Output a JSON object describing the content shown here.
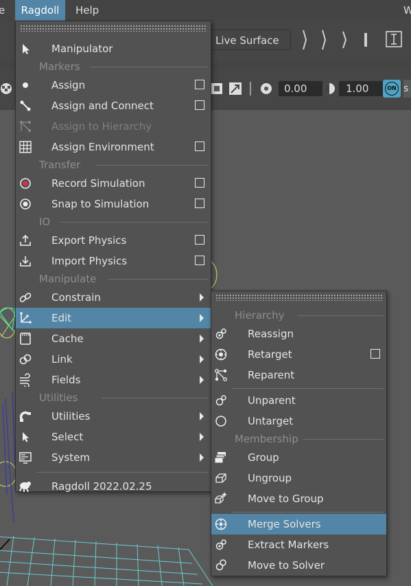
{
  "menubar": {
    "items": [
      {
        "label": "e",
        "active": false
      },
      {
        "label": "Ragdoll",
        "active": true
      },
      {
        "label": "Help",
        "active": false
      }
    ],
    "right_fragment": "W"
  },
  "toolbar": {
    "live_surface": "Live Surface",
    "field1": "0.00",
    "field2": "1.00",
    "on_badge": "ON",
    "partial": "s"
  },
  "main_menu": {
    "items": [
      {
        "type": "item",
        "label": "Manipulator",
        "icon": "pointer-icon"
      },
      {
        "type": "section",
        "label": "Markers"
      },
      {
        "type": "item",
        "label": "Assign",
        "icon": "dot-icon",
        "option": true
      },
      {
        "type": "item",
        "label": "Assign and Connect",
        "icon": "connect-icon",
        "option": true
      },
      {
        "type": "item",
        "label": "Assign to Hierarchy",
        "icon": "hierarchy-icon",
        "disabled": true
      },
      {
        "type": "item",
        "label": "Assign Environment",
        "icon": "grid-icon",
        "option": true
      },
      {
        "type": "section",
        "label": "Transfer"
      },
      {
        "type": "item",
        "label": "Record Simulation",
        "icon": "record-icon",
        "option": true
      },
      {
        "type": "item",
        "label": "Snap to Simulation",
        "icon": "snap-icon",
        "option": true
      },
      {
        "type": "section",
        "label": "IO"
      },
      {
        "type": "item",
        "label": "Export Physics",
        "icon": "export-icon",
        "option": true
      },
      {
        "type": "item",
        "label": "Import Physics",
        "icon": "import-icon",
        "option": true
      },
      {
        "type": "section",
        "label": "Manipulate"
      },
      {
        "type": "item",
        "label": "Constrain",
        "icon": "chain-icon",
        "submenu": true
      },
      {
        "type": "item",
        "label": "Edit",
        "icon": "edit-axes-icon",
        "submenu": true,
        "active": true
      },
      {
        "type": "item",
        "label": "Cache",
        "icon": "film-icon",
        "submenu": true
      },
      {
        "type": "item",
        "label": "Link",
        "icon": "link-icon",
        "submenu": true
      },
      {
        "type": "item",
        "label": "Fields",
        "icon": "wind-icon",
        "submenu": true
      },
      {
        "type": "section",
        "label": "Utilities"
      },
      {
        "type": "item",
        "label": "Utilities",
        "icon": "magnet-icon",
        "submenu": true
      },
      {
        "type": "item",
        "label": "Select",
        "icon": "select-arrow-icon",
        "submenu": true
      },
      {
        "type": "item",
        "label": "System",
        "icon": "monitor-icon",
        "submenu": true
      },
      {
        "type": "divider"
      },
      {
        "type": "item",
        "label": "Ragdoll 2022.02.25",
        "icon": "ragdoll-logo-icon"
      }
    ]
  },
  "sub_menu": {
    "items": [
      {
        "type": "section",
        "label": "Hierarchy"
      },
      {
        "type": "item",
        "label": "Reassign",
        "icon": "reassign-icon"
      },
      {
        "type": "item",
        "label": "Retarget",
        "icon": "target-icon",
        "option": true
      },
      {
        "type": "item",
        "label": "Reparent",
        "icon": "reparent-icon"
      },
      {
        "type": "divider"
      },
      {
        "type": "item",
        "label": "Unparent",
        "icon": "unparent-icon"
      },
      {
        "type": "item",
        "label": "Untarget",
        "icon": "circle-icon"
      },
      {
        "type": "section",
        "label": "Membership"
      },
      {
        "type": "item",
        "label": "Group",
        "icon": "group-icon"
      },
      {
        "type": "item",
        "label": "Ungroup",
        "icon": "ungroup-icon"
      },
      {
        "type": "item",
        "label": "Move to Group",
        "icon": "move-group-icon"
      },
      {
        "type": "divider"
      },
      {
        "type": "item",
        "label": "Merge Solvers",
        "icon": "merge-icon",
        "active": true
      },
      {
        "type": "item",
        "label": "Extract Markers",
        "icon": "extract-icon"
      },
      {
        "type": "item",
        "label": "Move to Solver",
        "icon": "move-solver-icon"
      }
    ]
  },
  "colors": {
    "highlight": "#5285a6",
    "menu_bg": "#525252",
    "section_text": "#8e8e8e",
    "record_red": "#e0303a",
    "on_badge": "#4fa3c4"
  }
}
